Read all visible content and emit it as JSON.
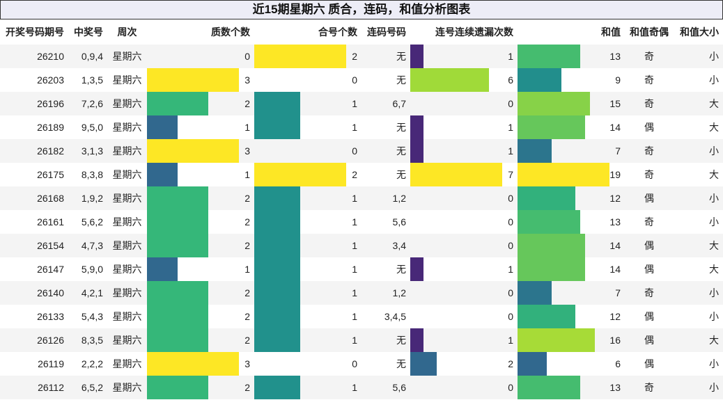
{
  "title": "近15期星期六 质合，连码，和值分析图表",
  "headers": [
    "开奖号码期号",
    "中奖号",
    "周次",
    "质数个数",
    "合号个数",
    "连码号码",
    "连号连续遗漏次数",
    "和值",
    "和值奇偶",
    "和值大小"
  ],
  "colors": {
    "c0": "#ffffff",
    "c1": "#31688e",
    "c2": "#35b779",
    "c3": "#fde725",
    "h1": "#21918c",
    "h2": "#fde725",
    "m1": "#482878",
    "m2": "#31688e",
    "m6": "#a0da39",
    "m7": "#fde725"
  },
  "chart_data": {
    "type": "table",
    "rows": [
      {
        "issue": "26210",
        "nums": "0,9,4",
        "week": "星期六",
        "prime": 0,
        "composite": 2,
        "consec": "无",
        "miss": 1,
        "sum": 13,
        "parity": "奇",
        "size": "小"
      },
      {
        "issue": "26203",
        "nums": "1,3,5",
        "week": "星期六",
        "prime": 3,
        "composite": 0,
        "consec": "无",
        "miss": 6,
        "sum": 9,
        "parity": "奇",
        "size": "小"
      },
      {
        "issue": "26196",
        "nums": "7,2,6",
        "week": "星期六",
        "prime": 2,
        "composite": 1,
        "consec": "6,7",
        "miss": 0,
        "sum": 15,
        "parity": "奇",
        "size": "大"
      },
      {
        "issue": "26189",
        "nums": "9,5,0",
        "week": "星期六",
        "prime": 1,
        "composite": 1,
        "consec": "无",
        "miss": 1,
        "sum": 14,
        "parity": "偶",
        "size": "大"
      },
      {
        "issue": "26182",
        "nums": "3,1,3",
        "week": "星期六",
        "prime": 3,
        "composite": 0,
        "consec": "无",
        "miss": 1,
        "sum": 7,
        "parity": "奇",
        "size": "小"
      },
      {
        "issue": "26175",
        "nums": "8,3,8",
        "week": "星期六",
        "prime": 1,
        "composite": 2,
        "consec": "无",
        "miss": 7,
        "sum": 19,
        "parity": "奇",
        "size": "大"
      },
      {
        "issue": "26168",
        "nums": "1,9,2",
        "week": "星期六",
        "prime": 2,
        "composite": 1,
        "consec": "1,2",
        "miss": 0,
        "sum": 12,
        "parity": "偶",
        "size": "小"
      },
      {
        "issue": "26161",
        "nums": "5,6,2",
        "week": "星期六",
        "prime": 2,
        "composite": 1,
        "consec": "5,6",
        "miss": 0,
        "sum": 13,
        "parity": "奇",
        "size": "小"
      },
      {
        "issue": "26154",
        "nums": "4,7,3",
        "week": "星期六",
        "prime": 2,
        "composite": 1,
        "consec": "3,4",
        "miss": 0,
        "sum": 14,
        "parity": "偶",
        "size": "大"
      },
      {
        "issue": "26147",
        "nums": "5,9,0",
        "week": "星期六",
        "prime": 1,
        "composite": 1,
        "consec": "无",
        "miss": 1,
        "sum": 14,
        "parity": "偶",
        "size": "大"
      },
      {
        "issue": "26140",
        "nums": "4,2,1",
        "week": "星期六",
        "prime": 2,
        "composite": 1,
        "consec": "1,2",
        "miss": 0,
        "sum": 7,
        "parity": "奇",
        "size": "小"
      },
      {
        "issue": "26133",
        "nums": "5,4,3",
        "week": "星期六",
        "prime": 2,
        "composite": 1,
        "consec": "3,4,5",
        "miss": 0,
        "sum": 12,
        "parity": "偶",
        "size": "小"
      },
      {
        "issue": "26126",
        "nums": "8,3,5",
        "week": "星期六",
        "prime": 2,
        "composite": 1,
        "consec": "无",
        "miss": 1,
        "sum": 16,
        "parity": "偶",
        "size": "大"
      },
      {
        "issue": "26119",
        "nums": "2,2,2",
        "week": "星期六",
        "prime": 3,
        "composite": 0,
        "consec": "无",
        "miss": 2,
        "sum": 6,
        "parity": "偶",
        "size": "小"
      },
      {
        "issue": "26112",
        "nums": "6,5,2",
        "week": "星期六",
        "prime": 2,
        "composite": 1,
        "consec": "5,6",
        "miss": 0,
        "sum": 13,
        "parity": "奇",
        "size": "小"
      }
    ]
  }
}
